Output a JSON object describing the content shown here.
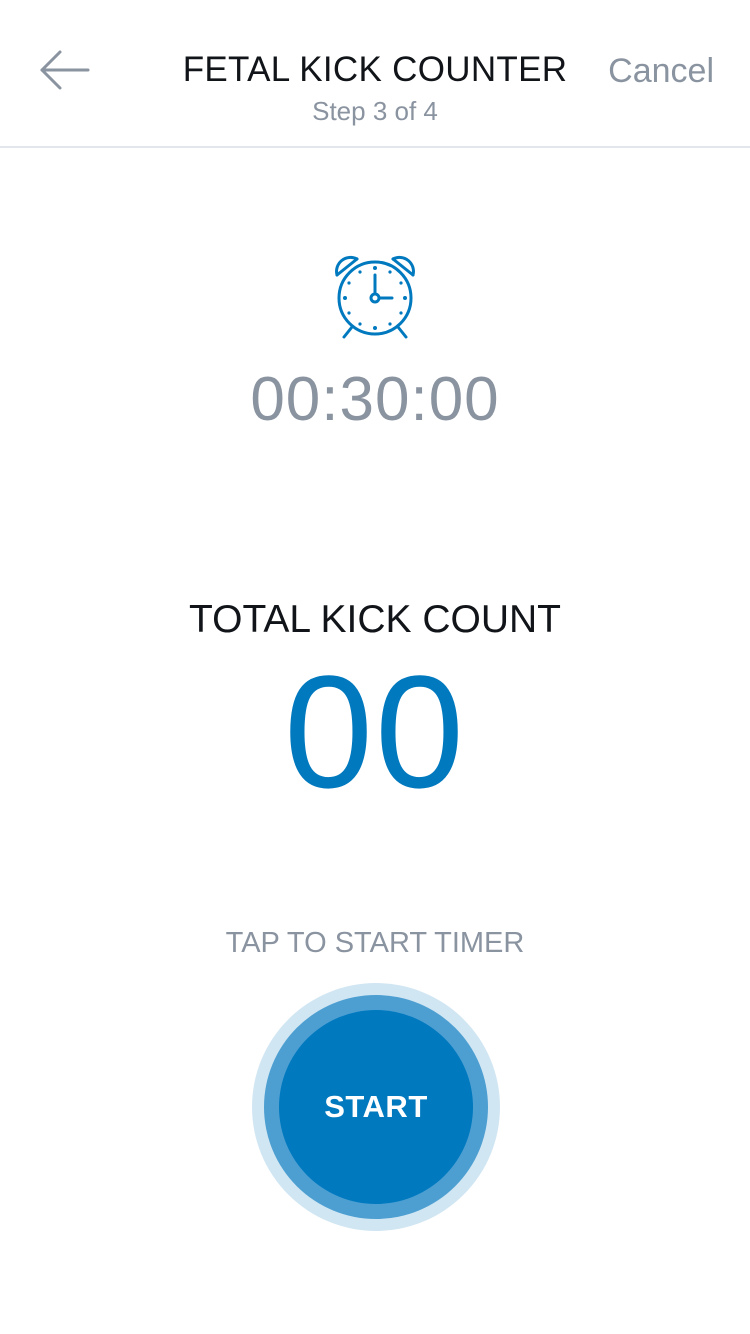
{
  "header": {
    "back_icon": "arrow-left-icon",
    "title": "FETAL KICK COUNTER",
    "subtitle": "Step 3 of 4",
    "cancel_label": "Cancel"
  },
  "timer": {
    "icon": "alarm-clock-icon",
    "value": "00:30:00"
  },
  "kicks": {
    "label": "TOTAL KICK COUNT",
    "count": "00"
  },
  "start": {
    "hint": "TAP TO START TIMER",
    "button_label": "START"
  },
  "colors": {
    "accent": "#0079bf",
    "accent_ring": "#4d9fd2",
    "accent_halo": "#d1e6f3",
    "muted_text": "#8a93a0",
    "primary_text": "#111418",
    "divider": "#e3e6ea"
  }
}
